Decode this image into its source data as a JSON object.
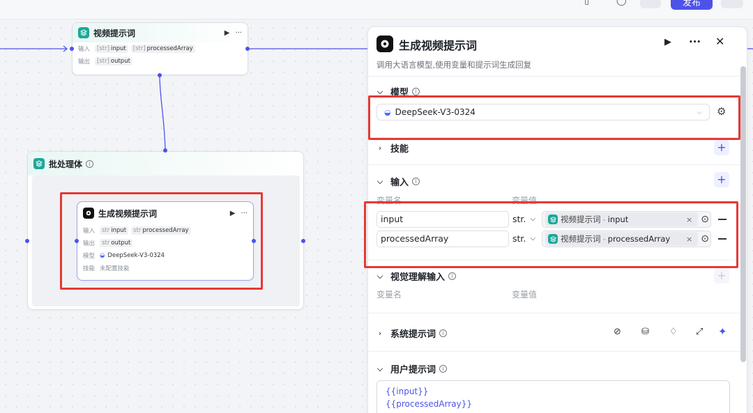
{
  "toolbar": {
    "publish_label": "发布"
  },
  "canvas": {
    "node_prompt": {
      "title": "视频提示词",
      "input_label": "输入",
      "output_label": "输出",
      "inputs": [
        {
          "type": "[str]",
          "name": "input"
        },
        {
          "type": "[str]",
          "name": "processedArray"
        }
      ],
      "outputs": [
        {
          "type": "[str]",
          "name": "output"
        }
      ]
    },
    "batch_group": {
      "title": "批处理体"
    },
    "node_llm": {
      "title": "生成视频提示词",
      "input_label": "输入",
      "output_label": "输出",
      "model_label": "模型",
      "skill_label": "技能",
      "inputs": [
        {
          "type": "str",
          "name": "input"
        },
        {
          "type": "str",
          "name": "processedArray"
        }
      ],
      "outputs": [
        {
          "type": "str",
          "name": "output"
        }
      ],
      "model_value": "DeepSeek-V3-0324",
      "skill_value": "未配置技能"
    }
  },
  "panel": {
    "title": "生成视频提示词",
    "description": "调用大语言模型,使用变量和提示词生成回复",
    "sections": {
      "model": {
        "title": "模型",
        "selected": "DeepSeek-V3-0324"
      },
      "skills": {
        "title": "技能"
      },
      "inputs": {
        "title": "输入",
        "col_name": "变量名",
        "col_value": "变量值",
        "rows": [
          {
            "name": "input",
            "type": "str.",
            "ref_node": "视频提示词",
            "ref_sep": "-",
            "ref_var": "input"
          },
          {
            "name": "processedArray",
            "type": "str.",
            "ref_node": "视频提示词",
            "ref_sep": "-",
            "ref_var": "processedArray"
          }
        ]
      },
      "vision": {
        "title": "视觉理解输入",
        "col_name": "变量名",
        "col_value": "变量值"
      },
      "system_prompt": {
        "title": "系统提示词"
      },
      "user_prompt": {
        "title": "用户提示词",
        "lines": [
          "{{input}}",
          "{{processedArray}}"
        ]
      }
    }
  },
  "colors": {
    "accent": "#4d53e8",
    "highlight_box": "#e53935",
    "node_icon_teal": "#1ba89a"
  }
}
